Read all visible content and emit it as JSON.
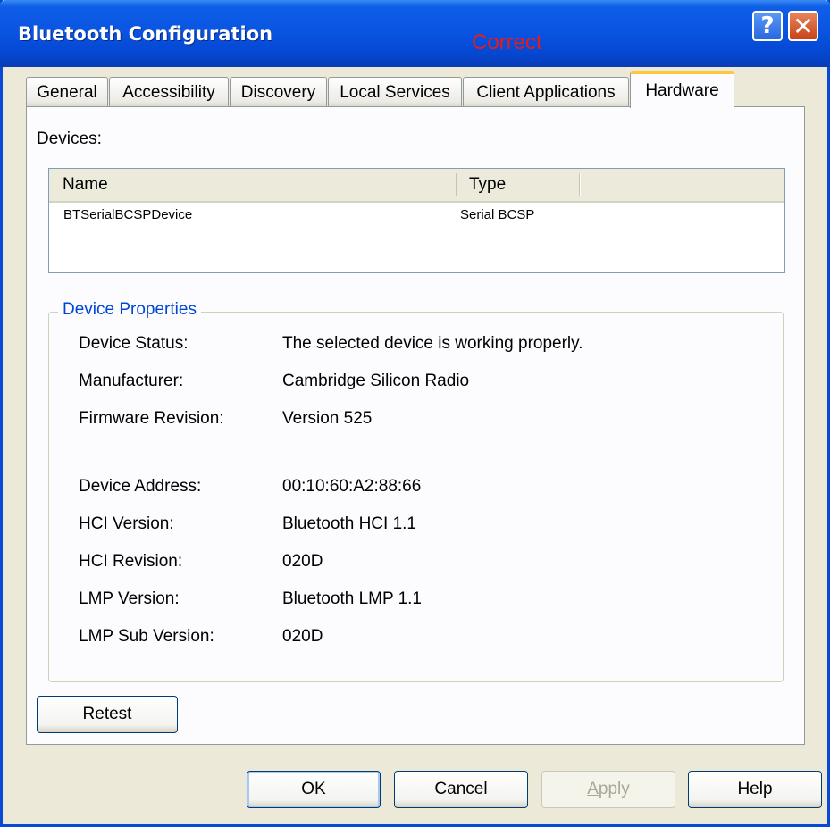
{
  "window": {
    "title": "Bluetooth Configuration",
    "annotation": "Correct",
    "help_glyph": "?",
    "close_glyph": "✕"
  },
  "tabs": [
    {
      "label": "General"
    },
    {
      "label": "Accessibility"
    },
    {
      "label": "Discovery"
    },
    {
      "label": "Local Services"
    },
    {
      "label": "Client Applications"
    },
    {
      "label": "Hardware",
      "active": true
    }
  ],
  "devices": {
    "label": "Devices:",
    "columns": [
      "Name",
      "Type"
    ],
    "rows": [
      {
        "name": "BTSerialBCSPDevice",
        "type": "Serial BCSP"
      }
    ]
  },
  "properties": {
    "title": "Device Properties",
    "items": [
      {
        "key": "Device Status:",
        "value": "The selected device is working properly."
      },
      {
        "key": "Manufacturer:",
        "value": "Cambridge Silicon Radio"
      },
      {
        "key": "Firmware Revision:",
        "value": "Version 525"
      },
      {
        "key": "Device Address:",
        "value": "00:10:60:A2:88:66"
      },
      {
        "key": "HCI Version:",
        "value": "Bluetooth HCI 1.1"
      },
      {
        "key": "HCI Revision:",
        "value": "020D"
      },
      {
        "key": "LMP Version:",
        "value": "Bluetooth LMP 1.1"
      },
      {
        "key": "LMP Sub Version:",
        "value": "020D"
      }
    ]
  },
  "buttons": {
    "retest": "Retest",
    "ok": "OK",
    "cancel": "Cancel",
    "apply": "Apply",
    "help": "Help"
  },
  "colors": {
    "title_bar": "#0a55e2",
    "group_title": "#0046d5",
    "annotation": "#e31d1d",
    "active_tab_accent": "#ffc83c"
  }
}
